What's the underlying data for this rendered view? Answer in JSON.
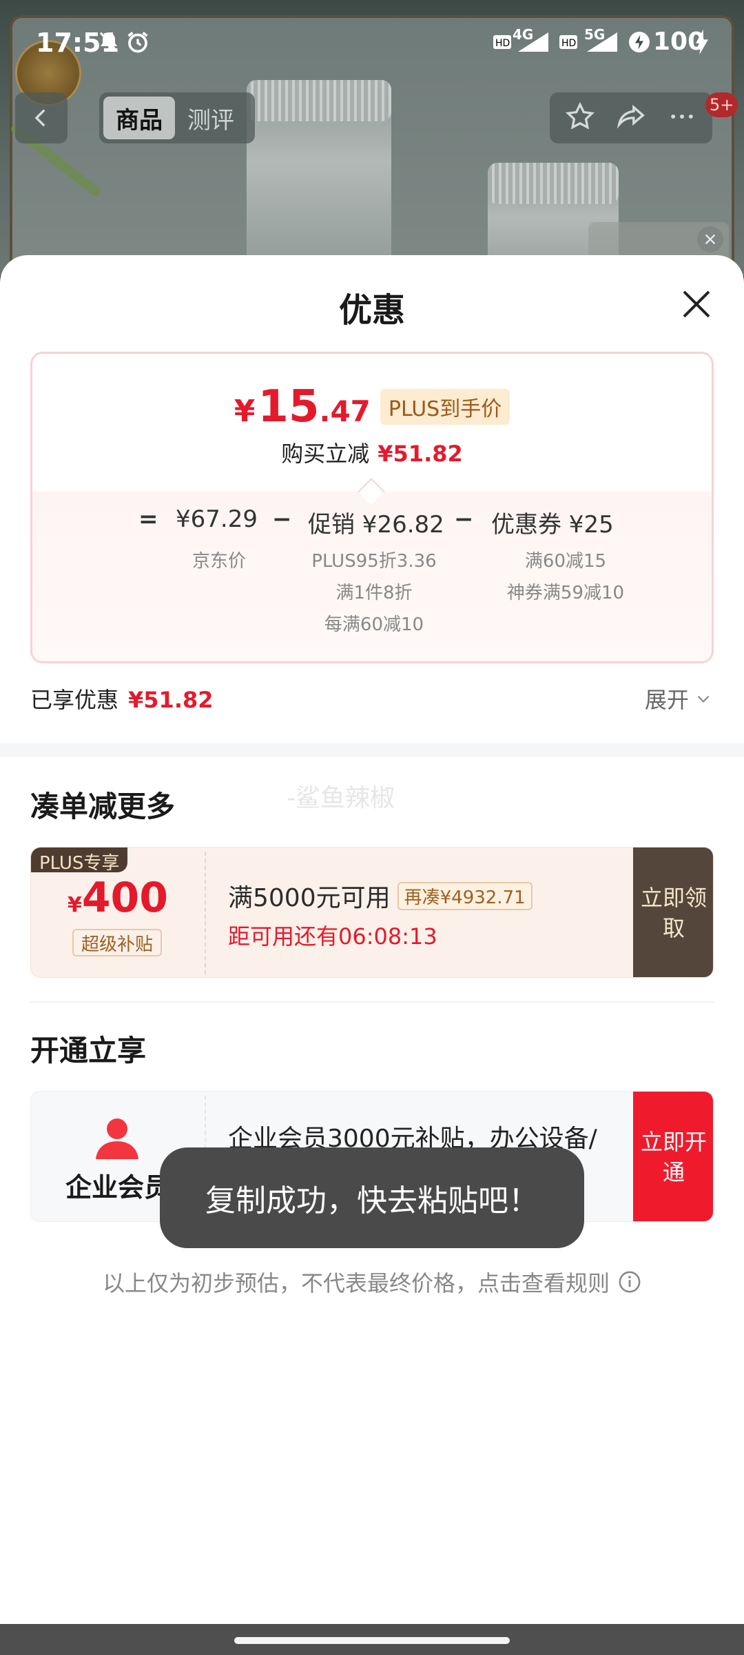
{
  "status_bar": {
    "time": "17:51",
    "network_1": "4G",
    "network_2": "5G",
    "battery": "100"
  },
  "top_nav": {
    "tabs": [
      {
        "label": "商品",
        "active": true
      },
      {
        "label": "测评",
        "active": false
      }
    ],
    "badge": "5+",
    "icons": [
      "back-icon",
      "star-icon",
      "share-icon",
      "more-icon"
    ]
  },
  "sheet": {
    "title": "优惠",
    "price_card": {
      "currency": "¥",
      "final_int": "15",
      "final_dec": ".47",
      "plus_tag": "PLUS到手价",
      "reduce_label": "购买立减",
      "reduce_value": "¥51.82",
      "formula": {
        "equals": "=",
        "base_price": "¥67.29",
        "base_label": "京东价",
        "minus1": "−",
        "promo": "促销 ¥26.82",
        "promo_details": [
          "PLUS95折3.36",
          "满1件8折",
          "每满60减10"
        ],
        "minus2": "−",
        "coupon": "优惠券 ¥25",
        "coupon_details": [
          "满60减15",
          "神券满59减10"
        ]
      }
    },
    "enjoyed_label": "已享优惠",
    "enjoyed_value": "¥51.82",
    "expand_label": "展开",
    "section_more": {
      "title": "凑单减更多",
      "watermark": "-鲨鱼辣椒",
      "coupon": {
        "plus_only": "PLUS专享",
        "currency": "¥",
        "amount": "400",
        "sub_tag": "超级补贴",
        "condition": "满5000元可用",
        "again": "再凑¥4932.71",
        "countdown": "距可用还有06:08:13",
        "action": "立即领取"
      }
    },
    "section_open": {
      "title": "开通立享",
      "member": {
        "label": "企业会员",
        "desc": "企业会员3000元补贴，办公设备/易耗品一站式采购！",
        "action": "立即开通"
      }
    },
    "disclaimer": "以上仅为初步预估，不代表最终价格，点击查看规则"
  },
  "toast": "复制成功，快去粘贴吧！",
  "colors": {
    "accent_red": "#e41a2c",
    "plus_brown": "#54463a",
    "toast_bg": "#4a4a4a"
  }
}
